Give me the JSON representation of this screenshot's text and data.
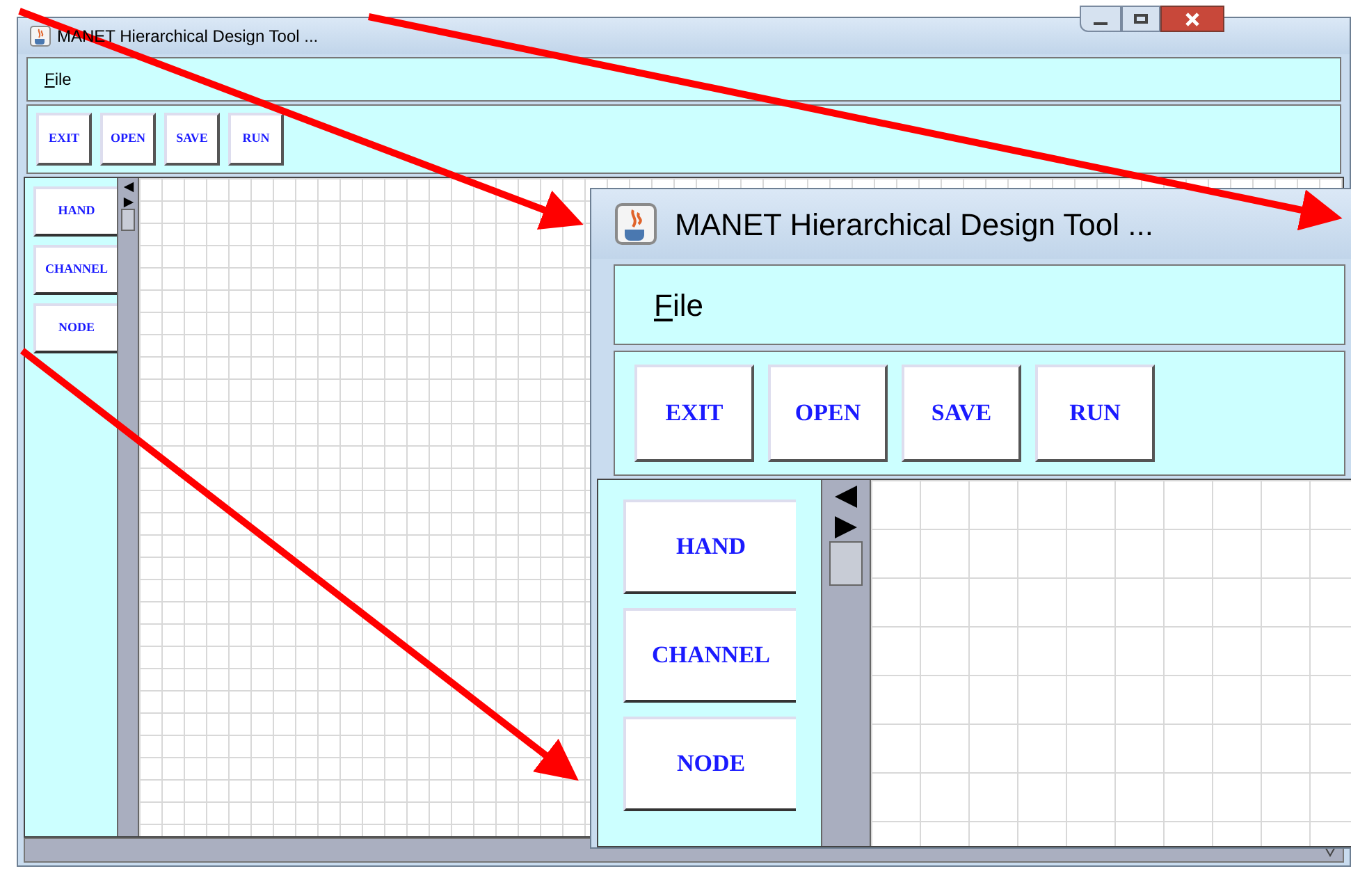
{
  "window": {
    "title": "MANET Hierarchical Design Tool ...",
    "menu": [
      "File"
    ],
    "toolbar": [
      "EXIT",
      "OPEN",
      "SAVE",
      "RUN"
    ],
    "palette": [
      "HAND",
      "CHANNEL",
      "NODE"
    ]
  },
  "magnified_view": {
    "title": "MANET Hierarchical Design Tool ...",
    "menu": [
      "File"
    ],
    "toolbar": [
      "EXIT",
      "OPEN",
      "SAVE",
      "RUN"
    ],
    "palette": [
      "HAND",
      "CHANNEL",
      "NODE"
    ]
  }
}
